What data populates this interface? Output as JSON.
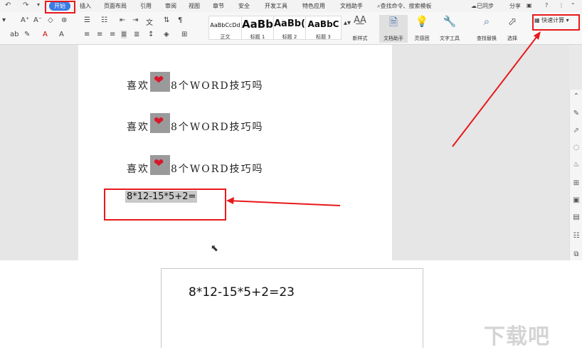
{
  "menubar": {
    "tabs": [
      "开始",
      "插入",
      "页面布局",
      "引用",
      "审阅",
      "视图",
      "章节",
      "安全",
      "开发工具",
      "特色应用",
      "文档助手"
    ],
    "active_tab": "开始",
    "search": "查找命令、搜索模板",
    "sync": "已同步",
    "share": "分享"
  },
  "ribbon": {
    "styles": [
      {
        "sample": "AaBbCcDd",
        "name": "正文"
      },
      {
        "sample": "AaBb",
        "name": "标题 1"
      },
      {
        "sample": "AaBb(",
        "name": "标题 2"
      },
      {
        "sample": "AaBbC",
        "name": "标题 3"
      }
    ],
    "new_style": "新样式",
    "doc_helper": "文档助手",
    "inspiration": "灵感团",
    "text_tools": "文字工具",
    "find_replace": "查找替换",
    "select": "选择",
    "quick_calc": "快速计算"
  },
  "document": {
    "lines": [
      "喜欢",
      "8个WORD技巧吗"
    ],
    "formula": "8*12-15*5+2="
  },
  "result": {
    "text": "8*12-15*5+2=23"
  },
  "watermark": "下载吧",
  "colors": {
    "accent": "#3c7be6",
    "highlight_red": "#e8191b",
    "heart": "#d8182a"
  }
}
